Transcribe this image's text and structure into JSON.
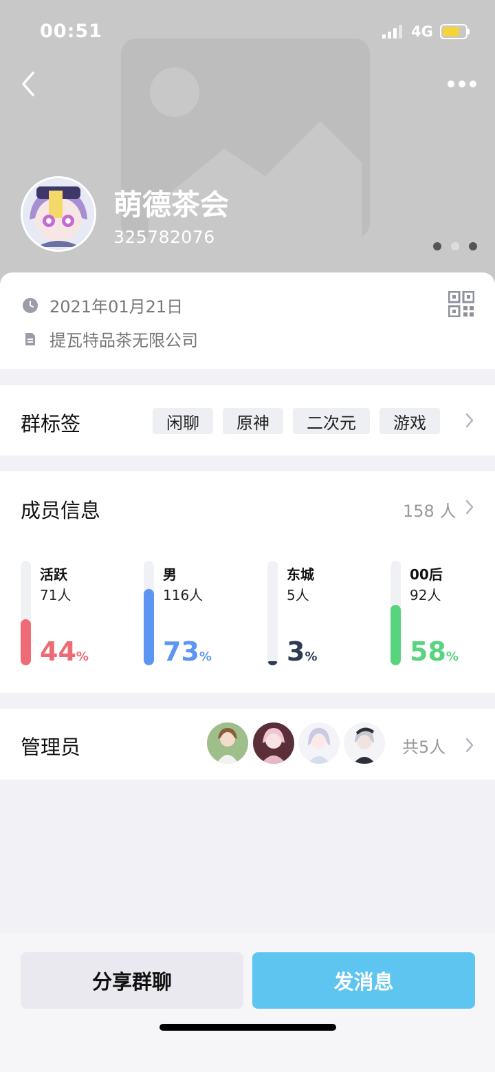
{
  "status": {
    "time": "00:51",
    "network": "4G"
  },
  "header": {
    "group_name": "萌德茶会",
    "group_id": "325782076"
  },
  "info": {
    "date": "2021年01月21日",
    "company": "提瓦特品茶无限公司"
  },
  "tags_section": {
    "title": "群标签",
    "tags": [
      "闲聊",
      "原神",
      "二次元",
      "游戏"
    ]
  },
  "members": {
    "title": "成员信息",
    "count": "158 人",
    "stats": [
      {
        "label": "活跃",
        "count": "71人",
        "percent": "44",
        "pct_symbol": "%",
        "fraction": 0.44,
        "color": "#ee6a74"
      },
      {
        "label": "男",
        "count": "116人",
        "percent": "73",
        "pct_symbol": "%",
        "fraction": 0.73,
        "color": "#5d95f2"
      },
      {
        "label": "东城",
        "count": "5人",
        "percent": "3",
        "pct_symbol": "%",
        "fraction": 0.03,
        "color": "#2e3b52"
      },
      {
        "label": "00后",
        "count": "92人",
        "percent": "58",
        "pct_symbol": "%",
        "fraction": 0.58,
        "color": "#58d47e"
      }
    ]
  },
  "admins": {
    "title": "管理员",
    "total": "共5人"
  },
  "actions": {
    "share_label": "分享群聊",
    "send_label": "发消息"
  }
}
